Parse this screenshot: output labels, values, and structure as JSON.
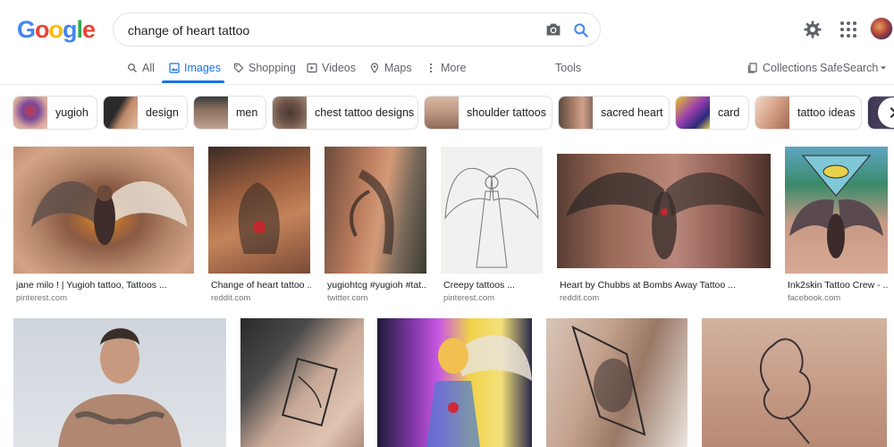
{
  "logo": {
    "letters": [
      "G",
      "o",
      "o",
      "g",
      "l",
      "e"
    ],
    "colors": [
      "#4285F4",
      "#EA4335",
      "#FBBC05",
      "#4285F4",
      "#34A853",
      "#EA4335"
    ]
  },
  "search": {
    "query": "change of heart tattoo"
  },
  "icons": {
    "camera": "camera-icon",
    "search": "search-icon",
    "settings": "gear-icon",
    "apps": "apps-grid-icon"
  },
  "tabs": {
    "all": "All",
    "images": "Images",
    "shopping": "Shopping",
    "videos": "Videos",
    "maps": "Maps",
    "more": "More",
    "tools": "Tools",
    "collections": "Collections",
    "safesearch": "SafeSearch"
  },
  "accent": "#1a73e8",
  "chips": [
    {
      "label": "yugioh"
    },
    {
      "label": "design"
    },
    {
      "label": "men"
    },
    {
      "label": "chest tattoo designs"
    },
    {
      "label": "shoulder tattoos"
    },
    {
      "label": "sacred heart"
    },
    {
      "label": "card"
    },
    {
      "label": "tattoo ideas"
    }
  ],
  "results_row1": [
    {
      "title": "jane milo ! | Yugioh tattoo, Tattoos ...",
      "source": "pinterest.com"
    },
    {
      "title": "Change of heart tattoo ...",
      "source": "reddit.com"
    },
    {
      "title": "yugiohtcg #yugioh #tat...",
      "source": "twitter.com"
    },
    {
      "title": "Creepy tattoos ...",
      "source": "pinterest.com"
    },
    {
      "title": "Heart by Chubbs at Bombs Away Tattoo ...",
      "source": "reddit.com"
    },
    {
      "title": "Ink2skin Tattoo Crew - ...",
      "source": "facebook.com"
    }
  ]
}
